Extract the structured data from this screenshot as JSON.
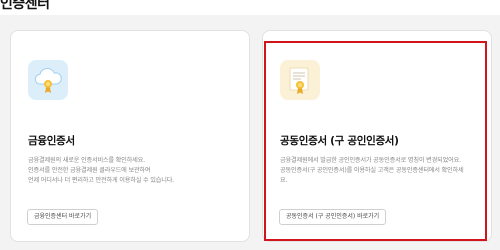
{
  "page_title": "인증센터",
  "colors": {
    "highlight_border": "#d2141c",
    "financial_icon_bg": "#dbeefa",
    "joint_icon_bg": "#fbf1d6"
  },
  "cards": [
    {
      "icon": "cloud-certificate-icon",
      "title": "금융인증서",
      "desc": [
        "금융결제원의 새로운 인증서비스를 확인하세요.",
        "인증서를 안전한 금융결제원 클라우드에 보관하여",
        "언제 어디서나 더 편리하고 안전하게 이용하실 수 있습니다."
      ],
      "button": "금융인증센터 바로가기"
    },
    {
      "icon": "certificate-document-icon",
      "title": "공동인증서 (구 공인인증서)",
      "desc": [
        "금융결제원에서 발급한 공인인증서가 공동인증서로 명칭이 변경되었어요.",
        "공동인증서(구 공인인증서)를 이용하실 고객은 공동인증센터에서 확인하세",
        "요."
      ],
      "button": "공동인증서 (구 공인인증서) 바로가기"
    }
  ]
}
